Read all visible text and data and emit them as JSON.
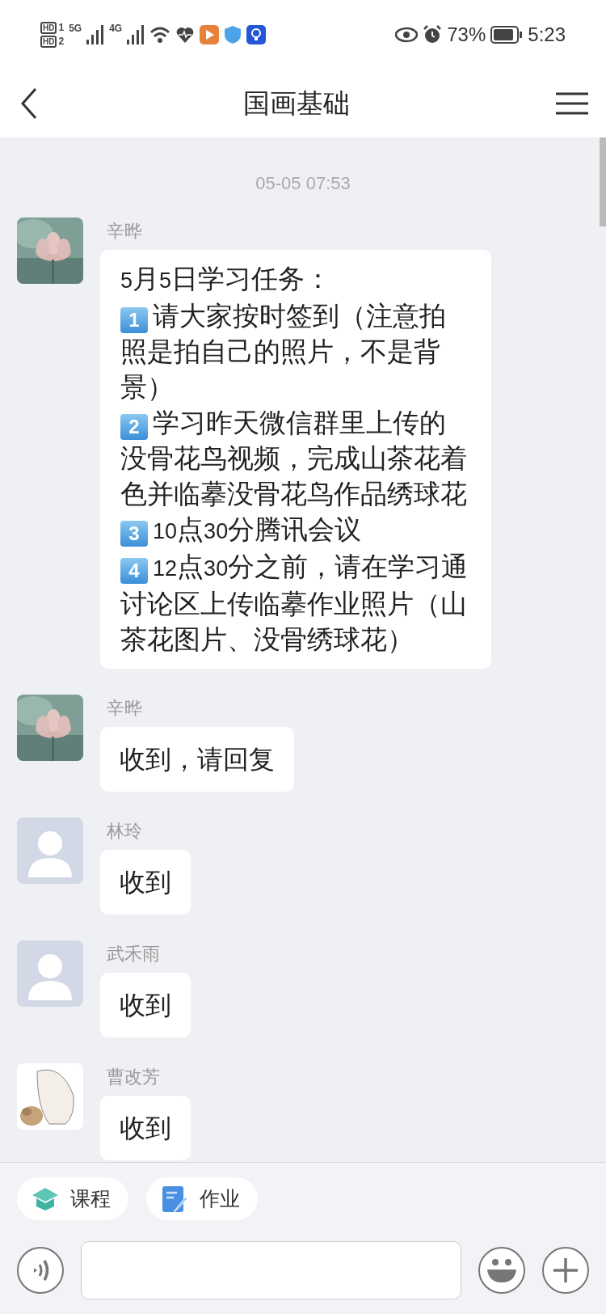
{
  "status_bar": {
    "sims": [
      {
        "label": "HD",
        "slot": "1"
      },
      {
        "label": "HD",
        "slot": "2"
      }
    ],
    "networks": [
      "5G",
      "4G"
    ],
    "battery": "73%",
    "time": "5:23"
  },
  "header": {
    "title": "国画基础"
  },
  "timestamp": "05-05 07:53",
  "messages": [
    {
      "sender": "辛晔",
      "kind": "picture",
      "lines": [
        {
          "text": "5月5日学习任务："
        },
        {
          "num": "1",
          "text": "请大家按时签到（注意拍照是拍自己的照片，不是背景）"
        },
        {
          "num": "2",
          "text": "学习昨天微信群里上传的没骨花鸟视频，完成山茶花着色并临摹没骨花鸟作品绣球花"
        },
        {
          "num": "3",
          "text": "10点30分腾讯会议"
        },
        {
          "num": "4",
          "text": "12点30分之前，请在学习通讨论区上传临摹作业照片（山茶花图片、没骨绣球花）"
        }
      ]
    },
    {
      "sender": "辛晔",
      "kind": "picture",
      "lines": [
        {
          "text": "收到，请回复"
        }
      ]
    },
    {
      "sender": "林玲",
      "kind": "default",
      "lines": [
        {
          "text": "收到"
        }
      ]
    },
    {
      "sender": "武禾雨",
      "kind": "default",
      "lines": [
        {
          "text": "收到"
        }
      ]
    },
    {
      "sender": "曹改芳",
      "kind": "picture",
      "lines": [
        {
          "text": "收到"
        }
      ]
    }
  ],
  "shortcuts": [
    {
      "kind": "course",
      "label": "课程"
    },
    {
      "kind": "homework",
      "label": "作业"
    }
  ]
}
